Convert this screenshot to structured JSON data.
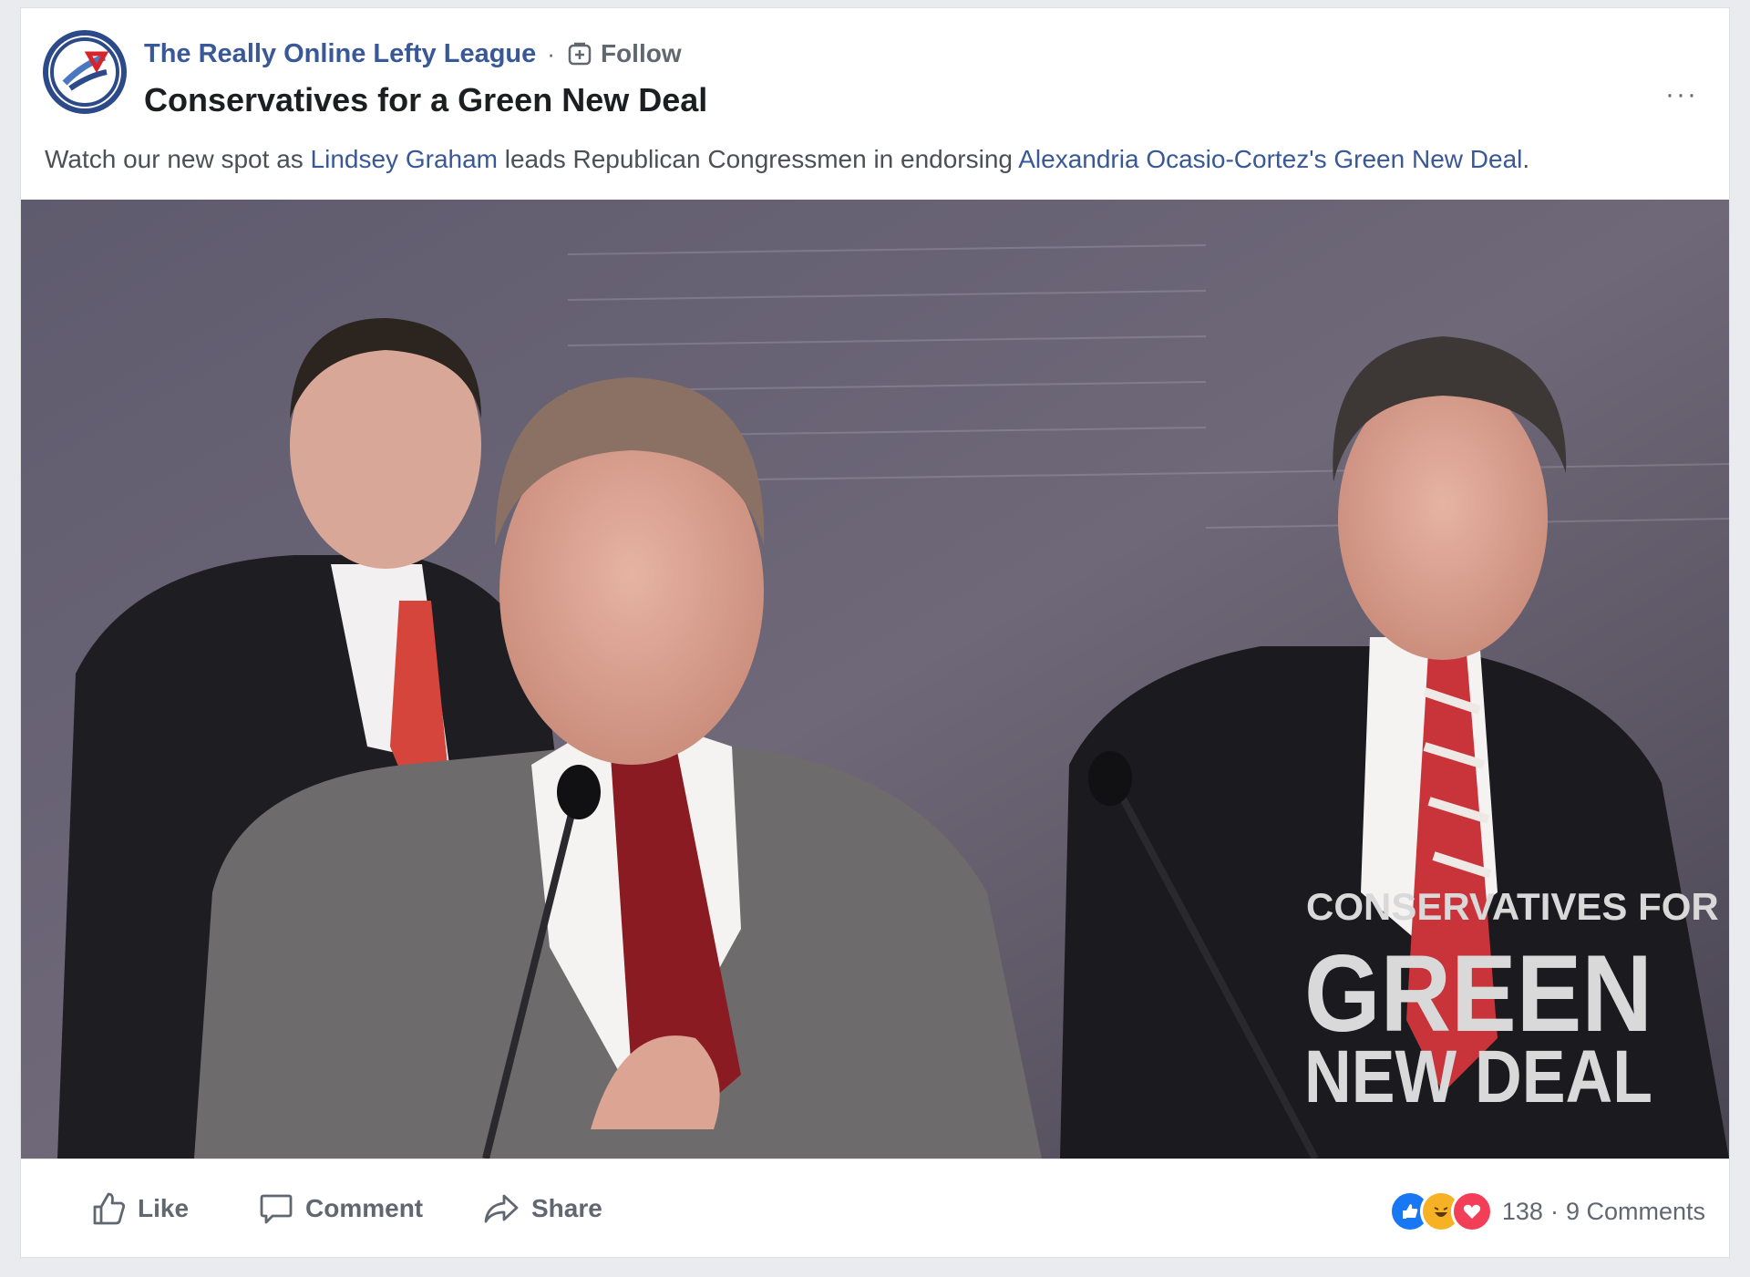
{
  "post": {
    "page_name": "The Really Online Lefty League",
    "separator": "·",
    "follow_label": "Follow",
    "title": "Conservatives for a Green New Deal",
    "more_label": "···",
    "description": {
      "part1": "Watch our new spot as ",
      "link1": "Lindsey Graham",
      "part2": " leads Republican Congressmen in endorsing ",
      "link2": "Alexandria Ocasio-Cortez's Green New Deal",
      "part3": "."
    }
  },
  "video": {
    "overlay_line1": "CONSERVATIVES FOR A",
    "overlay_line2": "GREEN",
    "overlay_line3": "NEW DEAL"
  },
  "actions": {
    "like_label": "Like",
    "comment_label": "Comment",
    "share_label": "Share"
  },
  "engagement": {
    "reaction_count": "138",
    "separator": "·",
    "comments_label": "9 Comments"
  },
  "colors": {
    "link": "#385898",
    "like_blue": "#1877f2",
    "love_red": "#f33e58",
    "haha_yellow": "#f7b125"
  }
}
